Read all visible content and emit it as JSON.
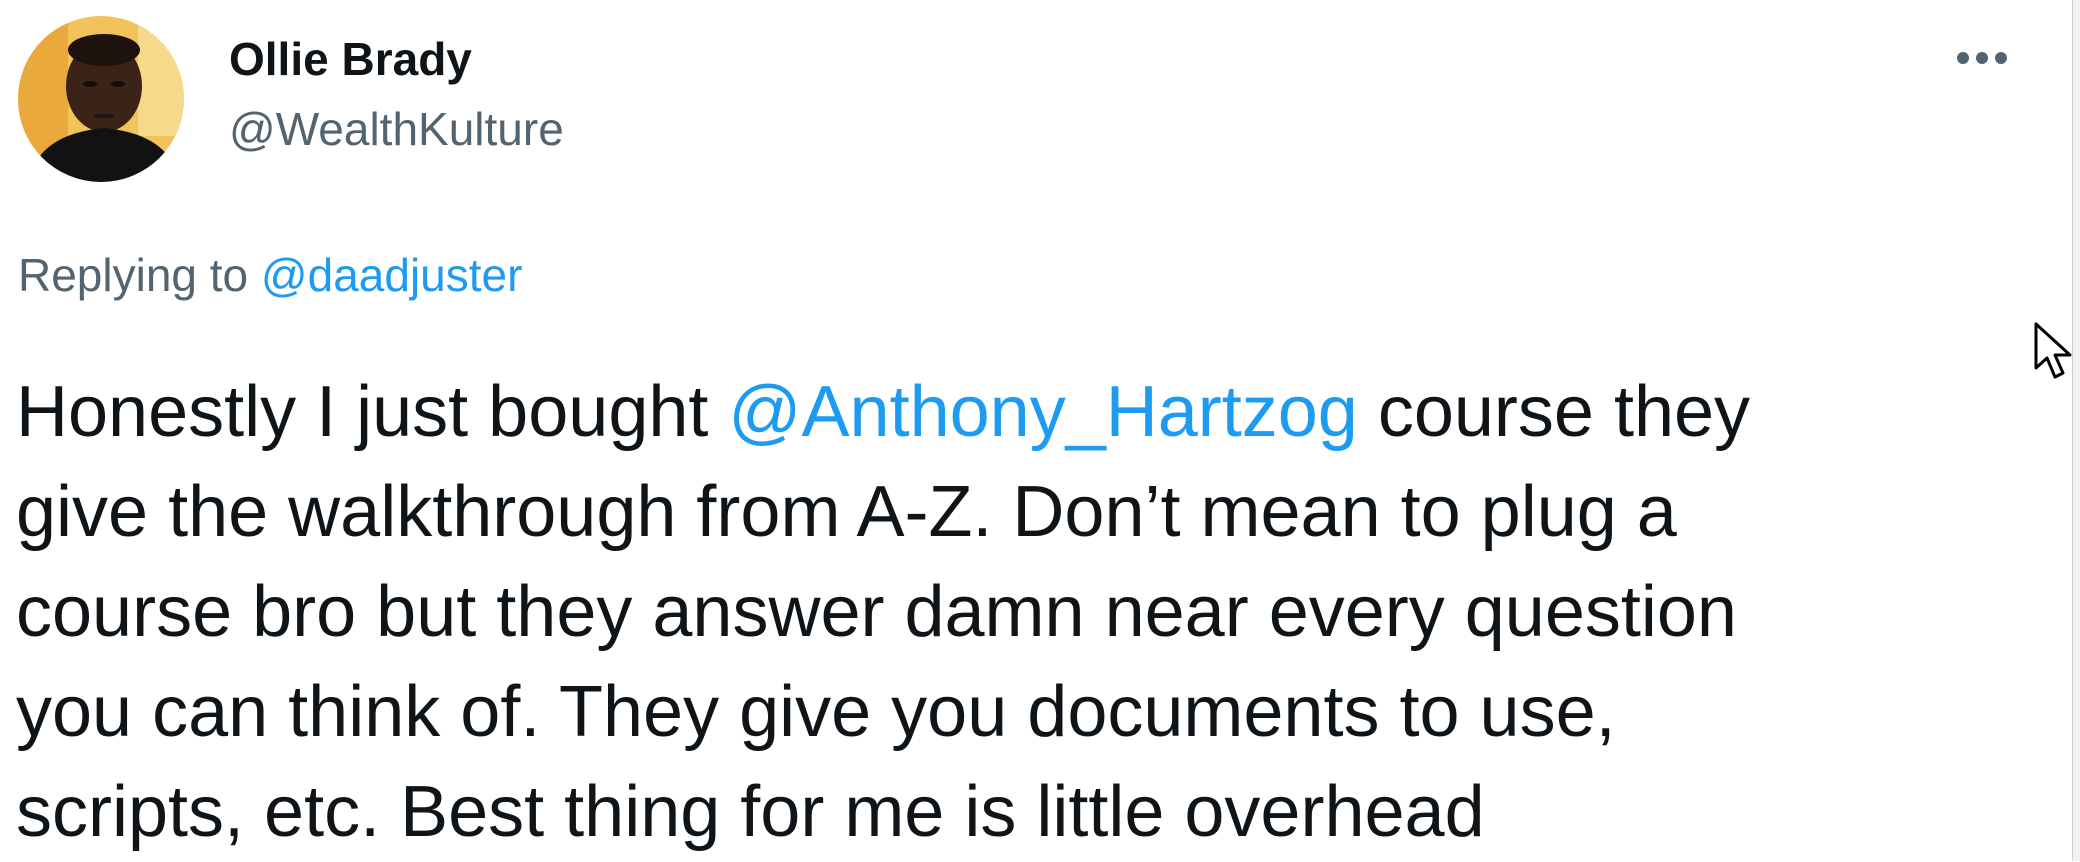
{
  "tweet": {
    "author": {
      "display_name": "Ollie Brady",
      "handle": "@WealthKulture",
      "avatar_icon": "profile-photo"
    },
    "more_icon": "more-horizontal-icon",
    "reply": {
      "prefix": "Replying to ",
      "mention": "@daadjuster"
    },
    "body": {
      "line1_before": "Honestly I just bought ",
      "line1_mention": "@Anthony_Hartzog",
      "line1_after": " course they",
      "line2": "give the walkthrough from A-Z. Don’t mean to plug a",
      "line3": "course bro but they answer damn near every question",
      "line4": "you can think of. They give you documents to use,",
      "line5": "scripts, etc. Best thing for me is little overhead"
    }
  },
  "colors": {
    "text_primary": "#0f1419",
    "text_secondary": "#536471",
    "link": "#1d9bf0",
    "background": "#ffffff"
  },
  "cursor_icon": "mouse-pointer-icon"
}
